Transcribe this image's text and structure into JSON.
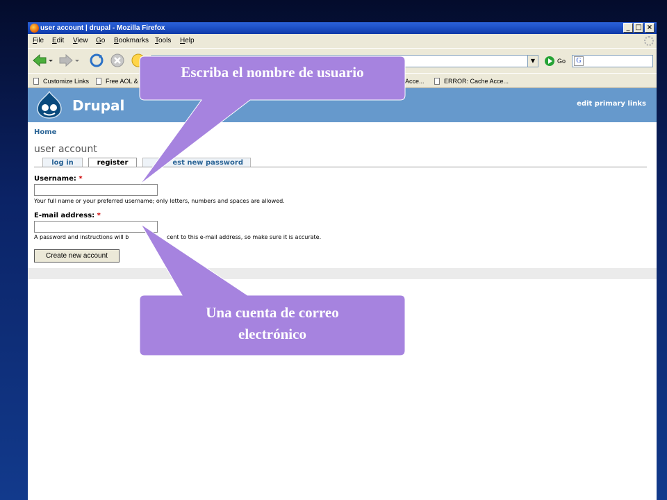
{
  "browser": {
    "window_title": "user account | drupal - Mozilla Firefox",
    "menu": [
      {
        "label": "File",
        "key": "F",
        "rest": "ile"
      },
      {
        "label": "Edit",
        "key": "E",
        "rest": "dit"
      },
      {
        "label": "View",
        "key": "V",
        "rest": "iew"
      },
      {
        "label": "Go",
        "key": "G",
        "rest": "o"
      },
      {
        "label": "Bookmarks",
        "key": "B",
        "rest": "ookmarks"
      },
      {
        "label": "Tools",
        "key": "T",
        "rest": "ools"
      },
      {
        "label": "Help",
        "key": "H",
        "rest": "elp"
      }
    ],
    "window_buttons": [
      "_",
      "□",
      "×"
    ],
    "go_label": "Go",
    "search_engine_glyph": "G",
    "bookmarks": [
      "Customize Links",
      "Free AOL &",
      "Acce...",
      "ERROR: Cache Acce..."
    ]
  },
  "site": {
    "name": "Drupal",
    "primary_links": "edit primary links",
    "header_color": "#6699cc"
  },
  "page": {
    "breadcrumb": "Home",
    "title": "user account",
    "tabs": [
      {
        "label": "log in",
        "active": false
      },
      {
        "label": "register",
        "active": true
      },
      {
        "label": "est new password",
        "active": false
      }
    ],
    "form": {
      "username_label": "Username:",
      "email_label": "E-mail address:",
      "required_marker": "*",
      "username_desc": "Your full name or your preferred username; only letters, numbers and spaces are allowed.",
      "email_desc_left": "A password and instructions will b",
      "email_desc_right": "cent to this e-mail address, so make sure it is accurate.",
      "submit_label": "Create new account"
    }
  },
  "callouts": {
    "username": "Escriba el nombre de usuario",
    "email_line1": "Una cuenta de correo",
    "email_line2": "electrónico",
    "color": "#a683df"
  }
}
